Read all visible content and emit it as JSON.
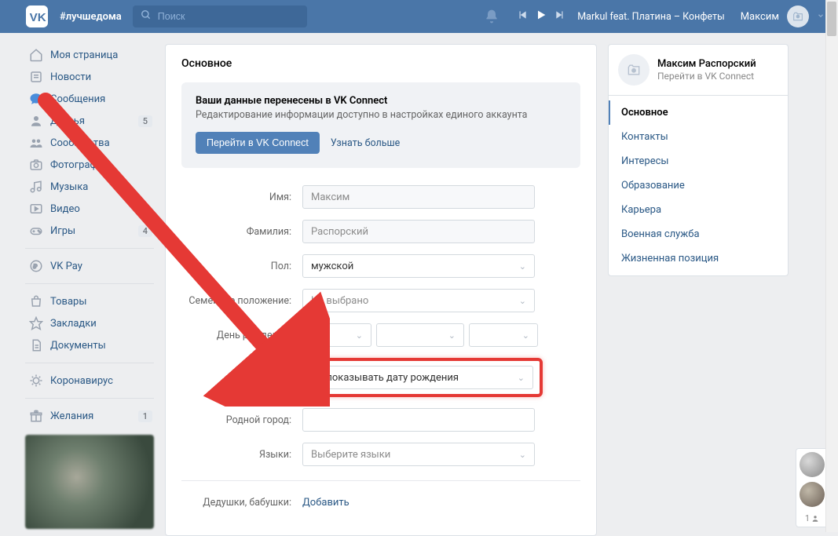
{
  "header": {
    "hashtag": "#лучшедома",
    "search_placeholder": "Поиск",
    "song": "Markul feat. Платина – Конфеты",
    "user_name": "Максим"
  },
  "sidebar": {
    "items": [
      {
        "label": "Моя страница"
      },
      {
        "label": "Новости"
      },
      {
        "label": "Сообщения"
      },
      {
        "label": "Друзья",
        "badge": "5"
      },
      {
        "label": "Сообщества"
      },
      {
        "label": "Фотографии"
      },
      {
        "label": "Музыка"
      },
      {
        "label": "Видео"
      },
      {
        "label": "Игры",
        "badge": "4"
      }
    ],
    "items2": [
      {
        "label": "VK Pay"
      }
    ],
    "items3": [
      {
        "label": "Товары"
      },
      {
        "label": "Закладки"
      },
      {
        "label": "Документы"
      }
    ],
    "items4": [
      {
        "label": "Коронавирус"
      }
    ],
    "items5": [
      {
        "label": "Желания",
        "badge": "1"
      }
    ]
  },
  "main": {
    "title": "Основное",
    "notice_title": "Ваши данные перенесены в VK Connect",
    "notice_sub": "Редактирование информации доступно в настройках единого аккаунта",
    "btn_go": "Перейти в VK Connect",
    "btn_more": "Узнать больше",
    "form": {
      "name_label": "Имя:",
      "name_value": "Максим",
      "surname_label": "Фамилия:",
      "surname_value": "Распорский",
      "sex_label": "Пол:",
      "sex_value": "мужской",
      "marital_label": "Семейное положение:",
      "marital_value": "Не выбрано",
      "birthday_label": "День рождения:",
      "birthday_vis": "Не показывать дату рождения",
      "hometown_label": "Родной город:",
      "hometown_value": "",
      "lang_label": "Языки:",
      "lang_value": "Выберите языки",
      "grandparents_label": "Дедушки, бабушки:",
      "grandparents_add": "Добавить"
    }
  },
  "right": {
    "profile_name": "Максим Распорский",
    "profile_sub": "Перейти в VK Connect",
    "tabs": [
      "Основное",
      "Контакты",
      "Интересы",
      "Образование",
      "Карьера",
      "Военная служба",
      "Жизненная позиция"
    ]
  },
  "float_widget": {
    "count": "1"
  }
}
